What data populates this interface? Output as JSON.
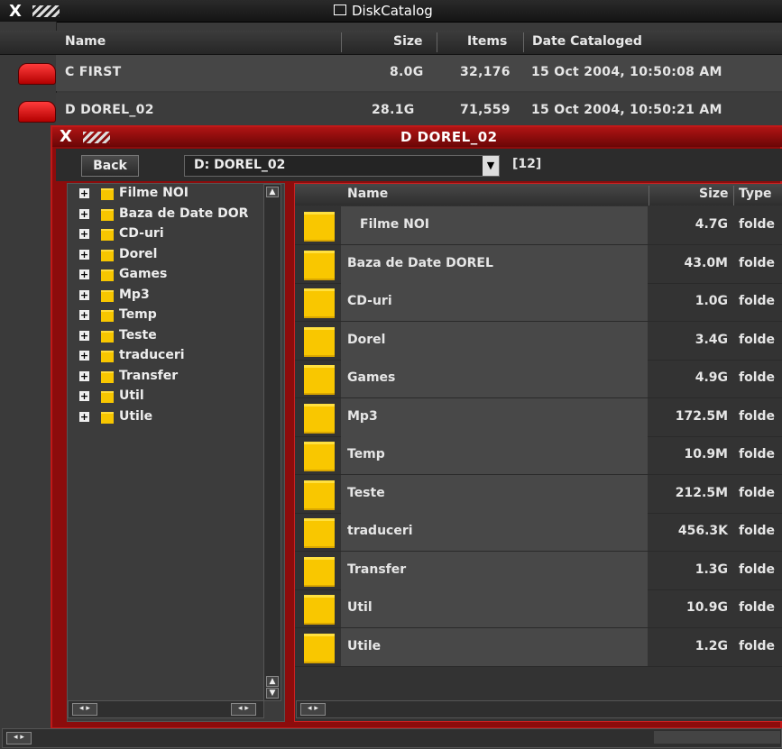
{
  "app": {
    "title": "DiskCatalog",
    "close_glyph": "X",
    "title_icon": "window-icon"
  },
  "columns": {
    "name": "Name",
    "size": "Size",
    "items": "Items",
    "date": "Date Cataloged"
  },
  "disks": [
    {
      "name": "C  FIRST",
      "size": "8.0G",
      "items": "32,176",
      "date": "15 Oct 2004, 10:50:08 AM"
    },
    {
      "name": "D  DOREL_02",
      "size": "28.1G",
      "items": "71,559",
      "date": "15 Oct 2004, 10:50:21 AM"
    }
  ],
  "browser": {
    "title": "D  DOREL_02",
    "back_label": "Back",
    "path_value": "D: DOREL_02",
    "count": "[12]",
    "list_columns": {
      "name": "Name",
      "size": "Size",
      "type": "Type"
    }
  },
  "tree": [
    "Filme NOI",
    "Baza de Date DOR",
    "CD-uri",
    "Dorel",
    "Games",
    "Mp3",
    "Temp",
    "Teste",
    "traduceri",
    "Transfer",
    "Util",
    "Utile"
  ],
  "files": [
    {
      "name": "Filme NOI",
      "size": "4.7G",
      "type": "folde"
    },
    {
      "name": "Baza de Date DOREL",
      "size": "43.0M",
      "type": "folde"
    },
    {
      "name": "CD-uri",
      "size": "1.0G",
      "type": "folde"
    },
    {
      "name": "Dorel",
      "size": "3.4G",
      "type": "folde"
    },
    {
      "name": "Games",
      "size": "4.9G",
      "type": "folde"
    },
    {
      "name": "Mp3",
      "size": "172.5M",
      "type": "folde"
    },
    {
      "name": "Temp",
      "size": "10.9M",
      "type": "folde"
    },
    {
      "name": "Teste",
      "size": "212.5M",
      "type": "folde"
    },
    {
      "name": "traduceri",
      "size": "456.3K",
      "type": "folde"
    },
    {
      "name": "Transfer",
      "size": "1.3G",
      "type": "folde"
    },
    {
      "name": "Util",
      "size": "10.9G",
      "type": "folde"
    },
    {
      "name": "Utile",
      "size": "1.2G",
      "type": "folde"
    }
  ],
  "colors": {
    "accent": "#c01818",
    "folder": "#f9c700",
    "disk": "#e01010"
  }
}
